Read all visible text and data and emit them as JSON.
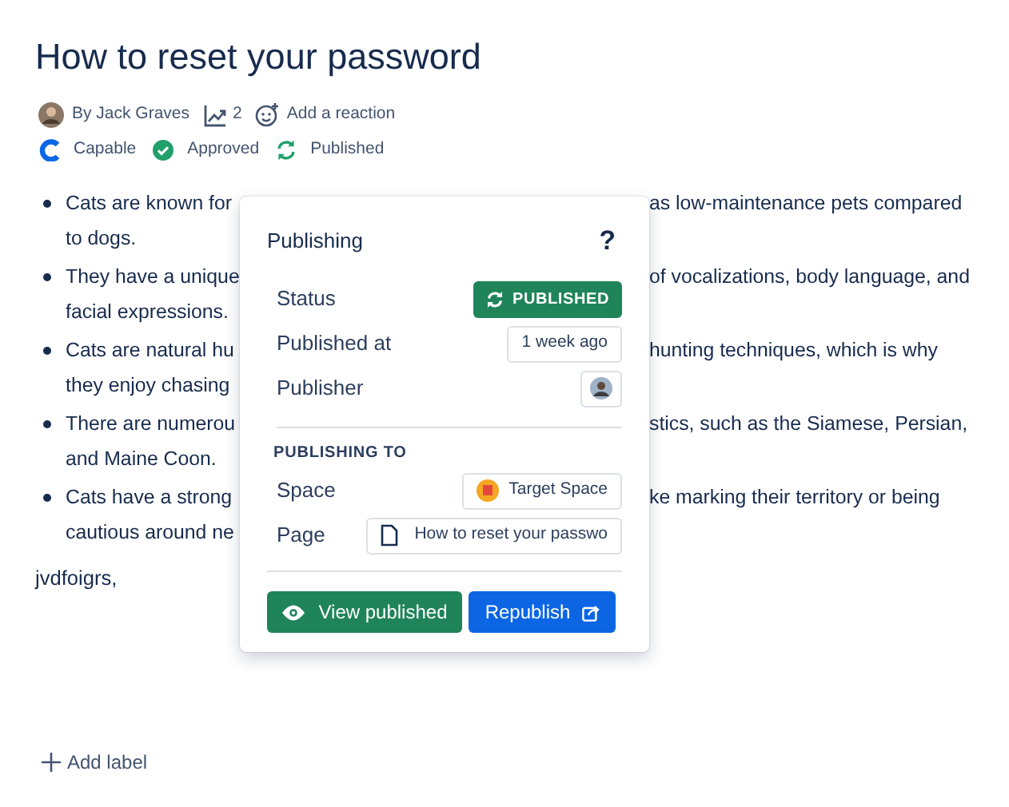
{
  "page": {
    "title": "How to reset your password"
  },
  "byline": {
    "author": "By Jack Graves",
    "views": "2",
    "reaction": "Add a reaction"
  },
  "statuses": [
    {
      "label": "Capable",
      "kind": "brand"
    },
    {
      "label": "Approved",
      "kind": "approved"
    },
    {
      "label": "Published",
      "kind": "published"
    }
  ],
  "bullets": [
    {
      "left": "Cats are known for",
      "right": "as low-maintenance pets compared",
      "continuation": "to dogs."
    },
    {
      "left": "They have a unique",
      "right": "of vocalizations, body language, and",
      "continuation": "facial expressions."
    },
    {
      "left": "Cats are natural hu",
      "right": "hunting techniques, which is why",
      "continuation": "they enjoy chasing"
    },
    {
      "left": "There are numerou",
      "right": "stics, such as the Siamese, Persian,",
      "continuation": "and Maine Coon."
    },
    {
      "left": "Cats have a strong",
      "right": "ke marking their territory or being",
      "continuation": "cautious around ne"
    }
  ],
  "paragraph": "jvdfoigrs,",
  "popover": {
    "title": "Publishing",
    "help": "?",
    "rows": [
      {
        "label": "Status",
        "kind": "status",
        "value": "PUBLISHED"
      },
      {
        "label": "Published at",
        "kind": "text",
        "value": "1 week ago"
      },
      {
        "label": "Publisher",
        "kind": "avatar"
      }
    ],
    "section": "PUBLISHING TO",
    "targets": [
      {
        "label": "Space",
        "kind": "space",
        "value": "Target Space"
      },
      {
        "label": "Page",
        "kind": "page",
        "value": "How to reset your passwo"
      }
    ],
    "buttons": [
      {
        "label": "View published",
        "kind": "view"
      },
      {
        "label": "Republish",
        "kind": "republish"
      }
    ]
  },
  "add_label": "Add label"
}
